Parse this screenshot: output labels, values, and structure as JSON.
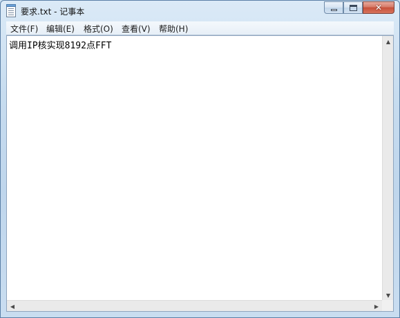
{
  "window": {
    "title": "要求.txt - 记事本"
  },
  "titlebar_controls": {
    "close_glyph": "✕"
  },
  "menu": {
    "items": [
      {
        "label": "文件(F)"
      },
      {
        "label": "编辑(E)"
      },
      {
        "label": "格式(O)"
      },
      {
        "label": "查看(V)"
      },
      {
        "label": "帮助(H)"
      }
    ]
  },
  "editor": {
    "content": "调用IP核实现8192点FFT"
  },
  "scrollbars": {
    "up": "▲",
    "down": "▼",
    "left": "◀",
    "right": "▶"
  },
  "colors": {
    "accent": "#5a7fa6",
    "close": "#c6503a"
  }
}
